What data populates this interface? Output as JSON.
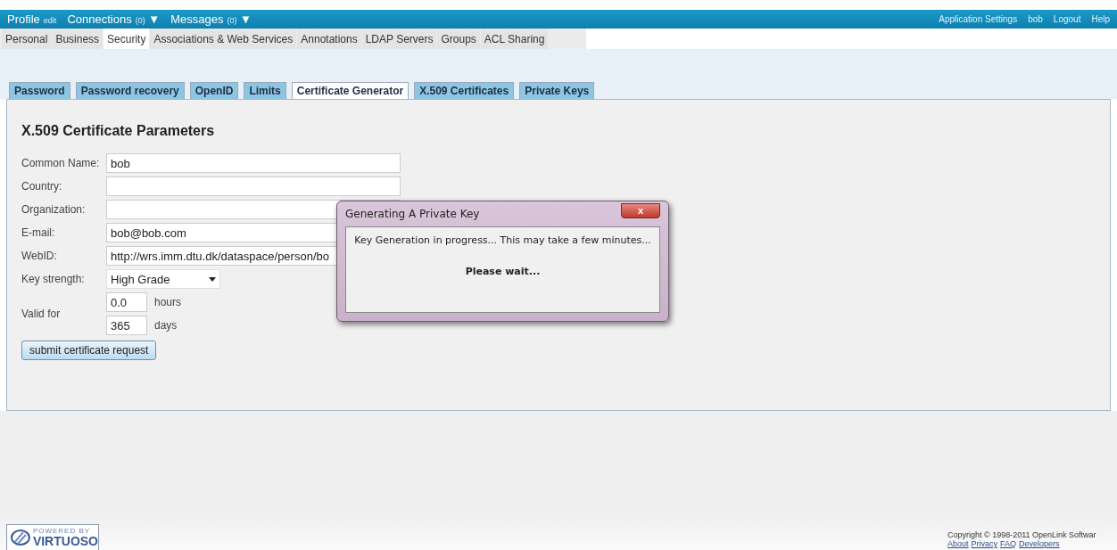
{
  "top_bar": {
    "left": [
      {
        "label": "Profile",
        "note": "edit"
      },
      {
        "label": "Connections",
        "note": "(0)",
        "caret": "▼"
      },
      {
        "label": "Messages",
        "note": "(0)",
        "caret": "▼"
      }
    ],
    "right": [
      "Application Settings",
      "bob",
      "Logout",
      "Help"
    ]
  },
  "nav_tabs": [
    {
      "label": "Personal",
      "selected": false
    },
    {
      "label": "Business",
      "selected": false
    },
    {
      "label": "Security",
      "selected": true
    },
    {
      "label": "Associations & Web Services",
      "selected": false
    },
    {
      "label": "Annotations",
      "selected": false
    },
    {
      "label": "LDAP Servers",
      "selected": false
    },
    {
      "label": "Groups",
      "selected": false
    },
    {
      "label": "ACL Sharing",
      "selected": false
    }
  ],
  "sub_tabs": [
    {
      "label": "Password",
      "selected": false
    },
    {
      "label": "Password recovery",
      "selected": false
    },
    {
      "label": "OpenID",
      "selected": false
    },
    {
      "label": "Limits",
      "selected": false
    },
    {
      "label": "Certificate Generator",
      "selected": true
    },
    {
      "label": "X.509 Certificates",
      "selected": false
    },
    {
      "label": "Private Keys",
      "selected": false
    }
  ],
  "heading": "X.509 Certificate Parameters",
  "fields": [
    {
      "kind": "text",
      "label": "Common Name:",
      "value": "bob"
    },
    {
      "kind": "text",
      "label": "Country:"
    },
    {
      "kind": "text",
      "label": "Organization:"
    },
    {
      "kind": "text",
      "label": "E-mail:",
      "value": "bob@bob.com"
    },
    {
      "kind": "text",
      "label": "WebID:",
      "value": "http://wrs.imm.dtu.dk/dataspace/person/bo"
    },
    {
      "kind": "select",
      "label": "Key strength:",
      "value": "High Grade"
    }
  ],
  "valid_for": {
    "label": "Valid for",
    "items": [
      {
        "value": "0.0",
        "unit": "hours"
      },
      {
        "value": "365",
        "unit": "days"
      }
    ]
  },
  "submit_button": "submit certificate request",
  "dialog": {
    "title": "Generating A Private Key",
    "close": "x",
    "message": "Key Generation in progress... This may take a few minutes...",
    "wait": "Please wait..."
  },
  "footer": {
    "logo_top": "POWERED BY",
    "logo_name": "VIRTUOSO",
    "copyright": "Copyright © 1998-2011 OpenLink Softwar",
    "links": [
      "About",
      "Privacy",
      "FAQ",
      "Developers"
    ]
  }
}
